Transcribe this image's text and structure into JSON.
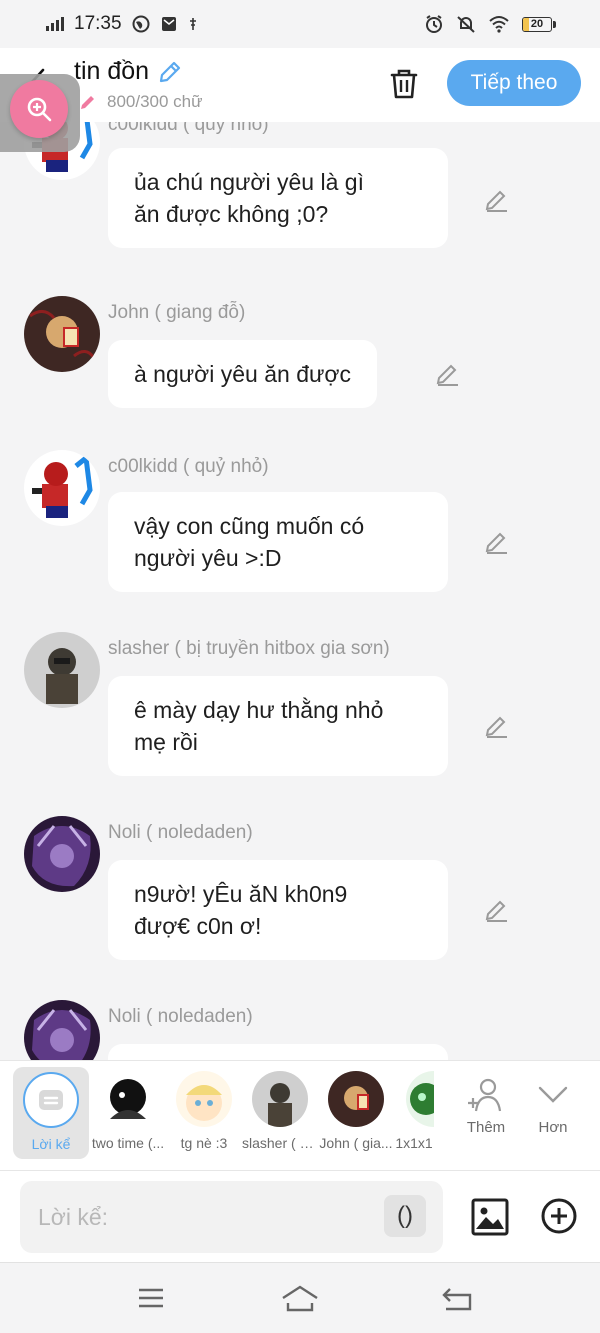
{
  "status": {
    "time": "17:35",
    "battery": "20",
    "battery_level": 0.2
  },
  "header": {
    "title": "tin đồn",
    "word_count": "800/300 chữ",
    "next_label": "Tiếp theo"
  },
  "messages": [
    {
      "name": "c00lkidd ( quỷ nhỏ)",
      "lines": [
        "ủa chú người yêu là gì",
        "ăn được không ;0?"
      ]
    },
    {
      "name": "John ( giang đỗ)",
      "lines": [
        "à người yêu ăn được"
      ]
    },
    {
      "name": "c00lkidd ( quỷ nhỏ)",
      "lines": [
        "vậy con cũng muốn có",
        "người yêu >:D"
      ]
    },
    {
      "name": "slasher ( bị truyền hitbox gia sơn)",
      "lines": [
        "ê mày dạy hư thằng nhỏ",
        "mẹ rồi"
      ]
    },
    {
      "name": "Noli ( noledaden)",
      "lines": [
        "n9ườ! yÊu ăN kh0n9",
        "đượ€ c0n ơ!"
      ]
    },
    {
      "name": "Noli ( noledaden)",
      "lines": [
        ""
      ]
    }
  ],
  "characters": [
    {
      "label": "Lời kể"
    },
    {
      "label": "two time (..."
    },
    {
      "label": "tg nè :3"
    },
    {
      "label": "slasher ( b..."
    },
    {
      "label": "John ( gia..."
    },
    {
      "label": "1x1x1"
    }
  ],
  "tools": {
    "more_label": "Thêm",
    "less_label": "Hơn"
  },
  "input": {
    "placeholder": "Lời kể:",
    "paren_label": "()"
  },
  "colors": {
    "accent": "#5aa9ef",
    "zoom": "#f07aa0",
    "bubble": "#ffffff",
    "background": "#f4f4f5"
  }
}
